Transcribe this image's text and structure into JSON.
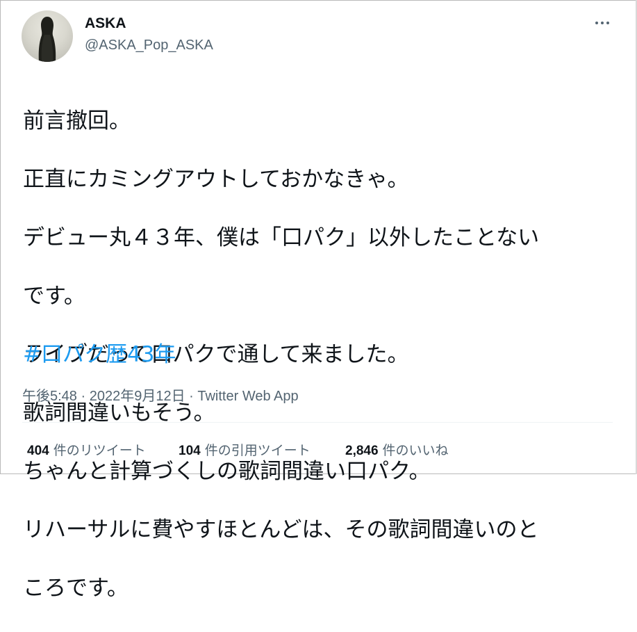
{
  "user": {
    "display_name": "ASKA",
    "handle": "@ASKA_Pop_ASKA"
  },
  "tweet": {
    "text_lines": [
      "前言撤回。",
      "正直にカミングアウトしておかなきゃ。",
      "デビュー丸４３年、僕は「口パク」以外したことない",
      "です。",
      "ライブだって口パクで通して来ました。",
      "歌詞間違いもそう。",
      "ちゃんと計算づくしの歌詞間違い口パク。",
      "リハーサルに費やすほとんどは、その歌詞間違いのと",
      "ころです。"
    ],
    "hashtag": "#口パク歴43年"
  },
  "meta": {
    "time": "午後5:48",
    "sep1": " · ",
    "date": "2022年9月12日",
    "sep2": " · ",
    "source": "Twitter Web App"
  },
  "stats": {
    "retweets": {
      "count": "404",
      "label": "件のリツイート"
    },
    "quotes": {
      "count": "104",
      "label": "件の引用ツイート"
    },
    "likes": {
      "count": "2,846",
      "label": "件のいいね"
    }
  },
  "icons": {
    "more": "more-horizontal-icon"
  },
  "colors": {
    "text": "#0f1419",
    "secondary": "#536471",
    "link": "#1d9bf0",
    "divider": "#eff3f4"
  }
}
